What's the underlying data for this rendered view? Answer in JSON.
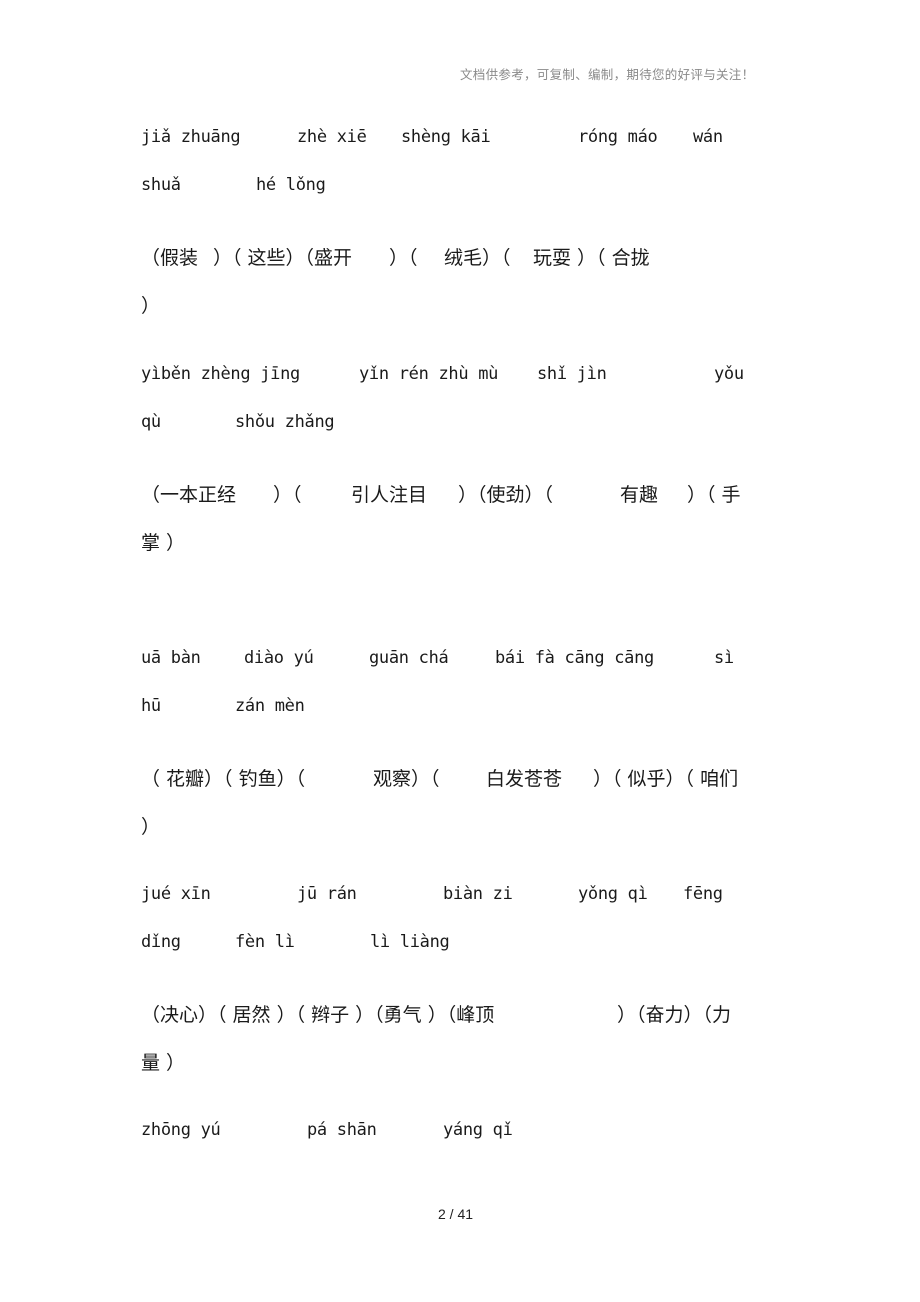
{
  "header_note": "文档供参考，可复制、编制，期待您的好评与关注！",
  "groups": [
    {
      "pinyin_line1": [
        "jiǎ zhuāng",
        "zhè xiē",
        "shèng kāi",
        "róng máo",
        "wán"
      ],
      "pinyin_line2": [
        "shuǎ",
        "hé lǒng"
      ],
      "hanzi_line1": [
        "（假装",
        "）（ 这些）（盛开",
        "）（",
        "绒毛）（",
        "玩耍 ）（ 合拢"
      ],
      "hanzi_line2": [
        "）"
      ]
    },
    {
      "pinyin_line1": [
        "yìběn zhèng jīng",
        "yǐn rén zhù mù",
        "shǐ jìn",
        "yǒu"
      ],
      "pinyin_line2": [
        "qù",
        "shǒu zhǎng"
      ],
      "hanzi_line1": [
        "（一本正经",
        "）（",
        "引人注目",
        "）（使劲）（",
        "有趣",
        "）（ 手"
      ],
      "hanzi_line2": [
        "掌 ）"
      ]
    },
    {
      "pinyin_line1": [
        "uā bàn",
        "diào yú",
        "guān chá",
        "bái fà cāng cāng",
        "sì"
      ],
      "pinyin_line2": [
        "hū",
        "zán mèn"
      ],
      "hanzi_line1": [
        "（ 花瓣）（ 钓鱼）（",
        "观察）（",
        "白发苍苍",
        "）（ 似乎）（ 咱们"
      ],
      "hanzi_line2": [
        "）"
      ]
    },
    {
      "pinyin_line1": [
        "jué xīn",
        "jū rán",
        "biàn zi",
        "yǒng qì",
        "fēng"
      ],
      "pinyin_line2": [
        "dǐng",
        "fèn lì",
        "lì liàng"
      ],
      "hanzi_line1": [
        "（决心）（ 居然 ）（ 辫子 ）（勇气 ）（峰顶",
        "）（奋力）（力"
      ],
      "hanzi_line2": [
        "量 ）"
      ]
    },
    {
      "pinyin_line1": [
        "zhōng yú",
        "pá shān",
        "yáng qǐ"
      ]
    }
  ],
  "footer": {
    "page_current": "2",
    "page_separator": " / ",
    "page_total": "41"
  }
}
